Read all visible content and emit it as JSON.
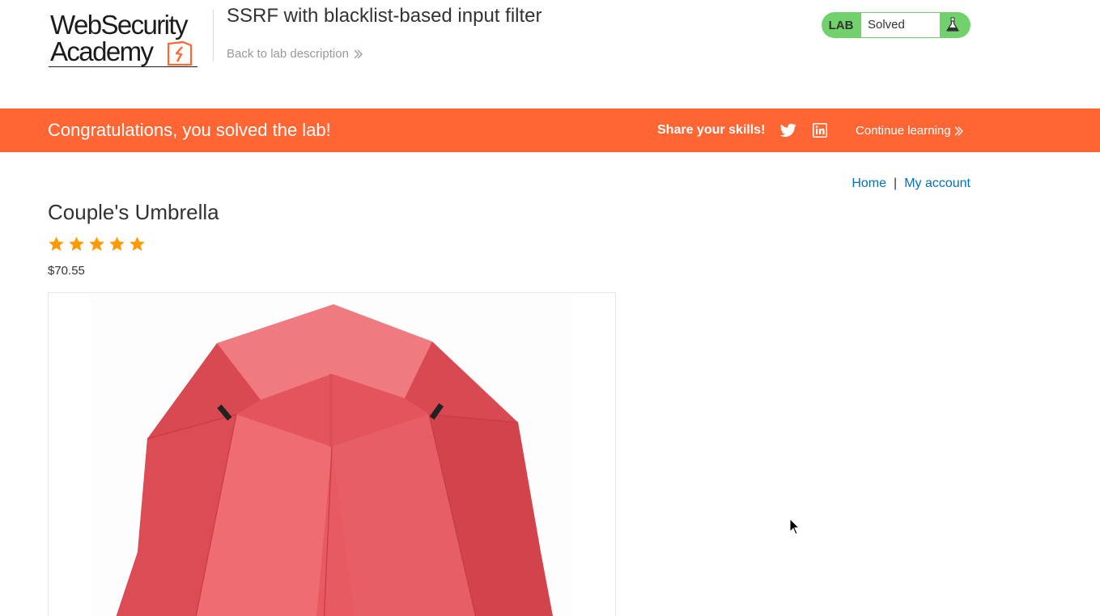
{
  "header": {
    "logo_text_line1": "WebSecurity",
    "logo_text_line2": "Academy",
    "lab_title": "SSRF with blacklist-based input filter",
    "back_link_label": "Back to lab description",
    "lab_badge_label": "LAB",
    "lab_status": "Solved"
  },
  "banner": {
    "message": "Congratulations, you solved the lab!",
    "share_label": "Share your skills!",
    "continue_label": "Continue learning",
    "icons": [
      "twitter-icon",
      "linkedin-icon"
    ]
  },
  "nav": {
    "home_label": "Home",
    "separator": "|",
    "account_label": "My account"
  },
  "product": {
    "name": "Couple's Umbrella",
    "rating_stars": 5,
    "rating_max": 5,
    "price": "$70.55",
    "image_subject": "red umbrella"
  },
  "colors": {
    "accent_orange": "#ff6633",
    "solved_green": "#70d16d",
    "link_blue": "#0071bc",
    "star_orange": "#ff9900"
  }
}
